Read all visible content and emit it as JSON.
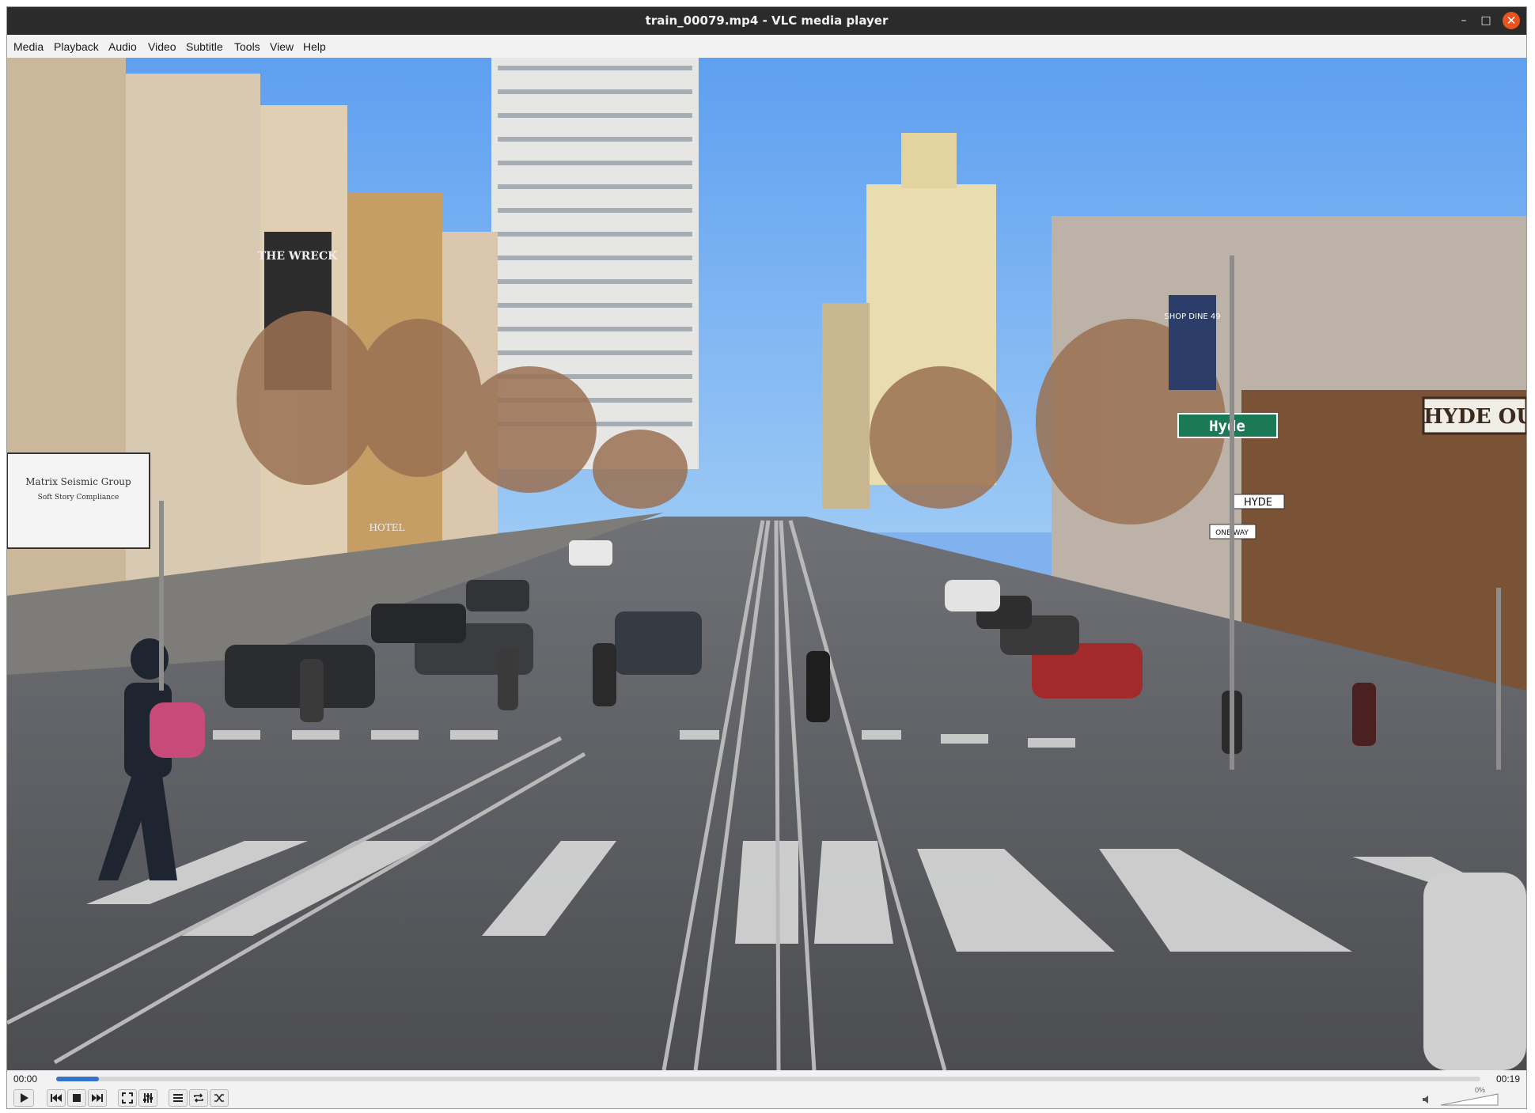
{
  "window": {
    "title": "train_00079.mp4 - VLC media player"
  },
  "menu": [
    "Media",
    "Playback",
    "Audio",
    "Video",
    "Subtitle",
    "Tools",
    "View",
    "Help"
  ],
  "playback": {
    "elapsed": "00:00",
    "total": "00:19",
    "progress": 0.03
  },
  "volume": {
    "label": "0%",
    "level": 0
  },
  "scene_signs": {
    "store": "HYDE OU",
    "street_sign": "Hyde",
    "street_blade": "HYDE",
    "hotel": "HOTEL",
    "shop_banner": "SHOP DINE 49",
    "billboard_line1": "Matrix Seismic Group",
    "billboard_line2": "Soft Story Compliance",
    "tower_sign": "THE WRECK",
    "oneway": "ONE WAY"
  },
  "icons": [
    "play-icon",
    "prev-icon",
    "stop-icon",
    "next-icon",
    "fullscreen-icon",
    "extended-settings-icon",
    "playlist-icon",
    "loop-icon",
    "shuffle-icon",
    "speaker-icon"
  ],
  "colors": {
    "titlebar": "#2b2b2b",
    "accent": "#3473c9",
    "close": "#e9541e"
  }
}
